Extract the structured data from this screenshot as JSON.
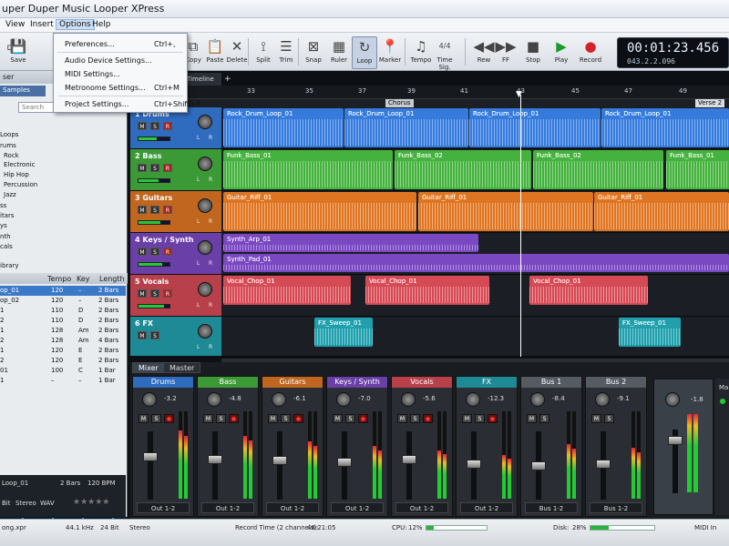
{
  "window": {
    "title": "uper Duper Music Looper XPress"
  },
  "menu": {
    "view": "View",
    "insert": "Insert",
    "options": "Options",
    "help": "Help"
  },
  "dropdown": [
    {
      "label": "Preferences...",
      "shortcut": "Ctrl+,"
    },
    {
      "label": "Audio Device Settings...",
      "shortcut": ""
    },
    {
      "label": "MIDI Settings...",
      "shortcut": ""
    },
    {
      "label": "Metronome Settings...",
      "shortcut": "Ctrl+M"
    },
    {
      "label": "Project Settings...",
      "shortcut": "Ctrl+Shift+P"
    }
  ],
  "toolbar": {
    "save": "Save",
    "copy": "Copy",
    "paste": "Paste",
    "delete": "Delete",
    "split": "Split",
    "trim": "Trim",
    "snap": "Snap",
    "ruler": "Ruler",
    "loop": "Loop",
    "marker": "Marker",
    "tempo": "Tempo",
    "timesig": "Time Sig.",
    "timesig_value": "4/4",
    "rew": "Rew",
    "ff": "FF",
    "stop": "Stop",
    "play": "Play",
    "record": "Record"
  },
  "lcd": {
    "time": "00:01:23.456",
    "beat": "043.2.2.096"
  },
  "left": {
    "header": "ser",
    "tab": "Samples",
    "search": "Search",
    "tree": [
      "Loops",
      "rums",
      "Rock",
      "Electronic",
      "Hip Hop",
      "Percussion",
      "Jazz",
      "ss",
      "itars",
      "ys",
      "nth",
      "cals",
      "ibrary"
    ],
    "cols": {
      "tempo": "Tempo",
      "key": "Key",
      "length": "Length"
    },
    "rows": [
      {
        "name": "op_01",
        "tempo": "120",
        "key": "–",
        "length": "2 Bars"
      },
      {
        "name": "op_02",
        "tempo": "120",
        "key": "–",
        "length": "2 Bars"
      },
      {
        "name": "1",
        "tempo": "110",
        "key": "D",
        "length": "2 Bars"
      },
      {
        "name": "2",
        "tempo": "110",
        "key": "D",
        "length": "2 Bars"
      },
      {
        "name": "1",
        "tempo": "128",
        "key": "Am",
        "length": "2 Bars"
      },
      {
        "name": "2",
        "tempo": "128",
        "key": "Am",
        "length": "4 Bars"
      },
      {
        "name": "1",
        "tempo": "120",
        "key": "E",
        "length": "2 Bars"
      },
      {
        "name": "2",
        "tempo": "120",
        "key": "E",
        "length": "2 Bars"
      },
      {
        "name": "01",
        "tempo": "100",
        "key": "C",
        "length": "1 Bar"
      },
      {
        "name": "1",
        "tempo": "–",
        "key": "–",
        "length": "1 Bar"
      }
    ],
    "preview": {
      "name": "Loop_01",
      "bars": "2 Bars",
      "bpm": "120 BPM",
      "bit": "Bit",
      "stereo": "Stereo",
      "format": "WAV",
      "stars": "★★★★★"
    }
  },
  "timeline": {
    "label": "Timeline",
    "plus": "+",
    "bars": [
      "33",
      "35",
      "37",
      "39",
      "41",
      "43",
      "45",
      "47",
      "49"
    ],
    "markers": {
      "chorus": "Chorus",
      "verse": "Verse 2"
    }
  },
  "tracks": [
    {
      "name": "1  Drums",
      "color": "#2f6bbf",
      "clips": [
        "Rock_Drum_Loop_01",
        "Rock_Drum_Loop_01",
        "Rock_Drum_Loop_01",
        "Rock_Drum_Loop_01"
      ]
    },
    {
      "name": "2  Bass",
      "color": "#3c9a36",
      "clips": [
        "Funk_Bass_01",
        "Funk_Bass_02",
        "Funk_Bass_02",
        "Funk_Bass_01"
      ]
    },
    {
      "name": "3  Guitars",
      "color": "#c0661e",
      "clips": [
        "Guitar_Riff_01",
        "Guitar_Riff_01",
        "Guitar_Riff_01"
      ]
    },
    {
      "name": "4  Keys / Synth",
      "color": "#6a3fa8",
      "clips": [
        "Synth_Arp_01",
        "Synth_Pad_01"
      ]
    },
    {
      "name": "5  Vocals",
      "color": "#b8404a",
      "clips": [
        "Vocal_Chop_01",
        "Vocal_Chop_01",
        "Vocal_Chop_01"
      ]
    },
    {
      "name": "6  FX",
      "color": "#1e8a96",
      "clips": [
        "FX_Sweep_01",
        "FX_Sweep_01"
      ]
    }
  ],
  "trackbtns": {
    "m": "M",
    "s": "S",
    "r": "R",
    "l": "L",
    "rr": "R"
  },
  "mixer": {
    "tab1": "Mixer",
    "tab2": "Master",
    "strips": [
      {
        "name": "Drums",
        "db": "-3.2",
        "out": "Out 1-2",
        "color": "#2f6bbf"
      },
      {
        "name": "Bass",
        "db": "-4.8",
        "out": "Out 1-2",
        "color": "#3c9a36"
      },
      {
        "name": "Guitars",
        "db": "-6.1",
        "out": "Out 1-2",
        "color": "#c0661e"
      },
      {
        "name": "Keys / Synth",
        "db": "-7.0",
        "out": "Out 1-2",
        "color": "#6a3fa8"
      },
      {
        "name": "Vocals",
        "db": "-5.6",
        "out": "Out 1-2",
        "color": "#b8404a"
      },
      {
        "name": "FX",
        "db": "-12.3",
        "out": "Out 1-2",
        "color": "#1e8a96"
      },
      {
        "name": "Bus 1",
        "db": "-8.4",
        "out": "Bus 1-2",
        "color": "#555b63"
      },
      {
        "name": "Bus 2",
        "db": "-9.1",
        "out": "Bus 1-2",
        "color": "#555b63"
      }
    ],
    "master": {
      "label": "Ma",
      "db": "-1.8"
    }
  },
  "status": {
    "file": "ong.xpr",
    "rate": "44.1 kHz",
    "bits": "24 Bit",
    "stereo": "Stereo",
    "rec": "Record Time (2 channels):",
    "rectime": "48:21:05",
    "cpu": "CPU:",
    "cpuval": "12%",
    "cpu_level": 0.12,
    "disk": "Disk:",
    "diskval": "28%",
    "disk_level": 0.28,
    "midi": "MIDI In"
  }
}
